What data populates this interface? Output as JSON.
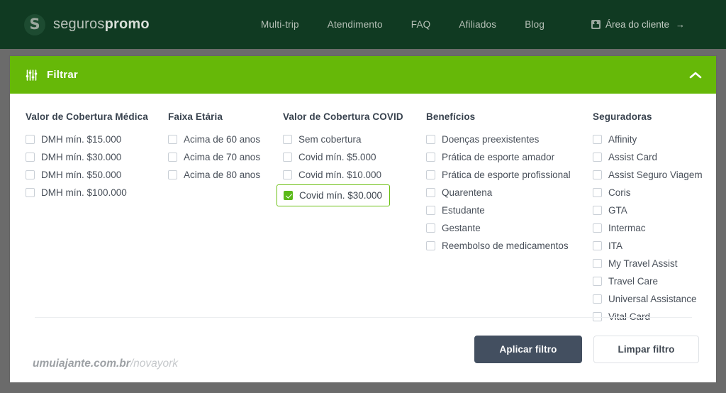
{
  "header": {
    "brand": {
      "prefix": "seguros",
      "suffix": "promo",
      "logo_icon": "seguros-promo-s-logo"
    },
    "nav": [
      {
        "label": "Multi-trip"
      },
      {
        "label": "Atendimento"
      },
      {
        "label": "FAQ"
      },
      {
        "label": "Afiliados"
      },
      {
        "label": "Blog"
      }
    ],
    "client_area": {
      "label": "Área do cliente",
      "arrow": "→",
      "icon": "user-card-icon"
    },
    "bg_color": "#103a22"
  },
  "filter_bar": {
    "title": "Filtrar",
    "icon": "sliders-icon",
    "collapse_icon": "chevron-up-icon",
    "bg_color": "#66b808"
  },
  "filter_columns": [
    {
      "title": "Valor de Cobertura Médica",
      "options": [
        {
          "label": "DMH mín. $15.000",
          "checked": false
        },
        {
          "label": "DMH mín. $30.000",
          "checked": false
        },
        {
          "label": "DMH mín. $50.000",
          "checked": false
        },
        {
          "label": "DMH mín. $100.000",
          "checked": false
        }
      ]
    },
    {
      "title": "Faixa Etária",
      "options": [
        {
          "label": "Acima de 60 anos",
          "checked": false
        },
        {
          "label": "Acima de 70 anos",
          "checked": false
        },
        {
          "label": "Acima de 80 anos",
          "checked": false
        }
      ]
    },
    {
      "title": "Valor de Cobertura COVID",
      "options": [
        {
          "label": "Sem cobertura",
          "checked": false
        },
        {
          "label": "Covid mín. $5.000",
          "checked": false
        },
        {
          "label": "Covid mín. $10.000",
          "checked": false
        },
        {
          "label": "Covid mín. $30.000",
          "checked": true,
          "highlighted": true
        }
      ]
    },
    {
      "title": "Benefícios",
      "options": [
        {
          "label": "Doenças preexistentes",
          "checked": false
        },
        {
          "label": "Prática de esporte amador",
          "checked": false
        },
        {
          "label": "Prática de esporte profissional",
          "checked": false
        },
        {
          "label": "Quarentena",
          "checked": false
        },
        {
          "label": "Estudante",
          "checked": false
        },
        {
          "label": "Gestante",
          "checked": false
        },
        {
          "label": "Reembolso de medicamentos",
          "checked": false
        }
      ]
    },
    {
      "title": "Seguradoras",
      "options": [
        {
          "label": "Affinity",
          "checked": false
        },
        {
          "label": "Assist Card",
          "checked": false
        },
        {
          "label": "Assist Seguro Viagem",
          "checked": false
        },
        {
          "label": "Coris",
          "checked": false
        },
        {
          "label": "GTA",
          "checked": false
        },
        {
          "label": "Intermac",
          "checked": false
        },
        {
          "label": "ITA",
          "checked": false
        },
        {
          "label": "My Travel Assist",
          "checked": false
        },
        {
          "label": "Travel Care",
          "checked": false
        },
        {
          "label": "Universal Assistance",
          "checked": false
        },
        {
          "label": "Vital Card",
          "checked": false
        }
      ]
    }
  ],
  "actions": {
    "apply_label": "Aplicar filtro",
    "clear_label": "Limpar filtro",
    "apply_color": "#434f60"
  },
  "watermark": {
    "domain": "umuiajante.com.br",
    "path": "/novayork"
  }
}
